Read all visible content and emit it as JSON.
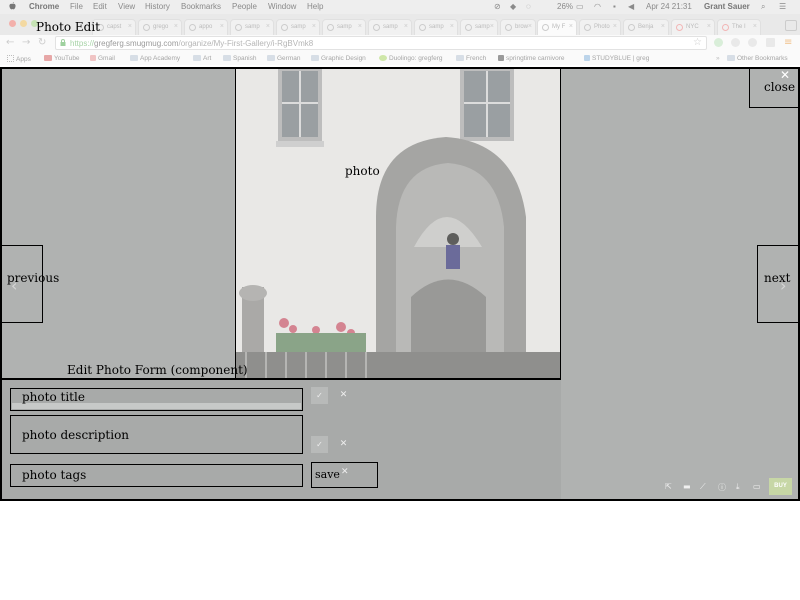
{
  "window": {
    "page_title": "Photo Edit"
  },
  "menubar": {
    "app": "Chrome",
    "items": [
      "File",
      "Edit",
      "View",
      "History",
      "Bookmarks",
      "People",
      "Window",
      "Help"
    ],
    "battery": "26%",
    "datetime": "Apr 24  21:31",
    "user": "Grant Sauer"
  },
  "tabs": [
    "capst",
    "grego",
    "appo",
    "samp",
    "samp",
    "samp",
    "samp",
    "samp",
    "samp",
    "samp",
    "brow",
    "My F",
    "Photo",
    "Benja",
    "NYC",
    "The I"
  ],
  "omnibox": {
    "scheme": "https://",
    "host": "gregferg.smugmug.com",
    "path": "/organize/My-First-Gallery/i-RgBVmk8"
  },
  "bookmarks": [
    {
      "label": "Apps",
      "icon": "apps-grid-icon"
    },
    {
      "label": "YouTube",
      "icon": "youtube-icon"
    },
    {
      "label": "Gmail",
      "icon": "gmail-icon"
    },
    {
      "label": "App Academy",
      "icon": "folder-icon"
    },
    {
      "label": "Art",
      "icon": "folder-icon"
    },
    {
      "label": "Spanish",
      "icon": "folder-icon"
    },
    {
      "label": "German",
      "icon": "folder-icon"
    },
    {
      "label": "Graphic Design",
      "icon": "folder-icon"
    },
    {
      "label": "Duolingo: gregferg",
      "icon": "duolingo-icon"
    },
    {
      "label": "French",
      "icon": "folder-icon"
    },
    {
      "label": "springtime carnivore",
      "icon": "page-icon"
    },
    {
      "label": "STUDYBLUE | greg",
      "icon": "studyblue-icon"
    },
    {
      "label": "Other Bookmarks",
      "icon": "folder-icon"
    }
  ],
  "viewer": {
    "photo_label": "photo",
    "close_label": "close",
    "previous_label": "previous",
    "next_label": "next",
    "form_title": "Edit Photo Form (component)",
    "fields": {
      "title_label": "photo title",
      "description_label": "photo description",
      "tags_label": "photo tags"
    },
    "save_label": "save",
    "buy_label": "BUY"
  },
  "colors": {
    "overlay": "#b0b2b1",
    "buy": "#c7d7a6"
  }
}
